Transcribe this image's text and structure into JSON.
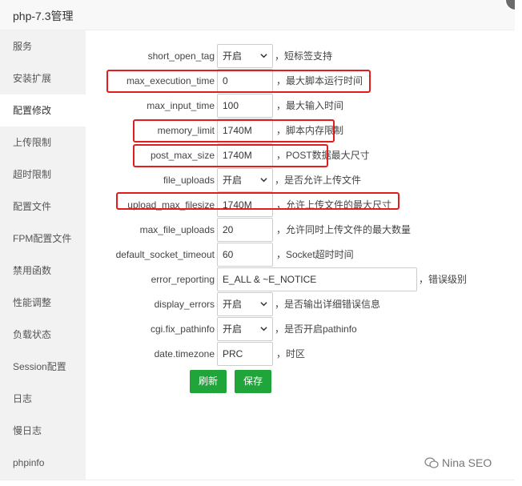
{
  "window": {
    "title": "php-7.3管理"
  },
  "sidebar": {
    "items": [
      {
        "label": "服务"
      },
      {
        "label": "安装扩展"
      },
      {
        "label": "配置修改",
        "active": true
      },
      {
        "label": "上传限制"
      },
      {
        "label": "超时限制"
      },
      {
        "label": "配置文件"
      },
      {
        "label": "FPM配置文件"
      },
      {
        "label": "禁用函数"
      },
      {
        "label": "性能调整"
      },
      {
        "label": "负载状态"
      },
      {
        "label": "Session配置"
      },
      {
        "label": "日志"
      },
      {
        "label": "慢日志"
      },
      {
        "label": "phpinfo"
      }
    ]
  },
  "settings": [
    {
      "label": "short_open_tag",
      "type": "select",
      "value": "开启",
      "desc": "，短标签支持"
    },
    {
      "label": "max_execution_time",
      "type": "text",
      "value": "0",
      "desc": "，最大脚本运行时间",
      "highlighted": true
    },
    {
      "label": "max_input_time",
      "type": "text",
      "value": "100",
      "desc": "，最大输入时间"
    },
    {
      "label": "memory_limit",
      "type": "text",
      "value": "1740M",
      "desc": "，脚本内存限制",
      "highlighted": true
    },
    {
      "label": "post_max_size",
      "type": "text",
      "value": "1740M",
      "desc": "，POST数据最大尺寸",
      "highlighted": true
    },
    {
      "label": "file_uploads",
      "type": "select",
      "value": "开启",
      "desc": "，是否允许上传文件"
    },
    {
      "label": "upload_max_filesize",
      "type": "text",
      "value": "1740M",
      "desc": "，允许上传文件的最大尺寸",
      "highlighted": true
    },
    {
      "label": "max_file_uploads",
      "type": "text",
      "value": "20",
      "desc": "，允许同时上传文件的最大数量"
    },
    {
      "label": "default_socket_timeout",
      "type": "text",
      "value": "60",
      "desc": "，Socket超时时间"
    },
    {
      "label": "error_reporting",
      "type": "wide",
      "value": "E_ALL & ~E_NOTICE",
      "desc": "，错误级别"
    },
    {
      "label": "display_errors",
      "type": "select",
      "value": "开启",
      "desc": "，是否输出详细错误信息"
    },
    {
      "label": "cgi.fix_pathinfo",
      "type": "select",
      "value": "开启",
      "desc": "，是否开启pathinfo"
    },
    {
      "label": "date.timezone",
      "type": "text",
      "value": "PRC",
      "desc": "，时区"
    }
  ],
  "actions": {
    "refresh_label": "刷新",
    "save_label": "保存"
  },
  "watermark": {
    "text": "Nina SEO"
  },
  "colors": {
    "accent": "#20a53a",
    "highlight": "#e21d1d",
    "sidebar_bg": "#f2f2f2"
  }
}
